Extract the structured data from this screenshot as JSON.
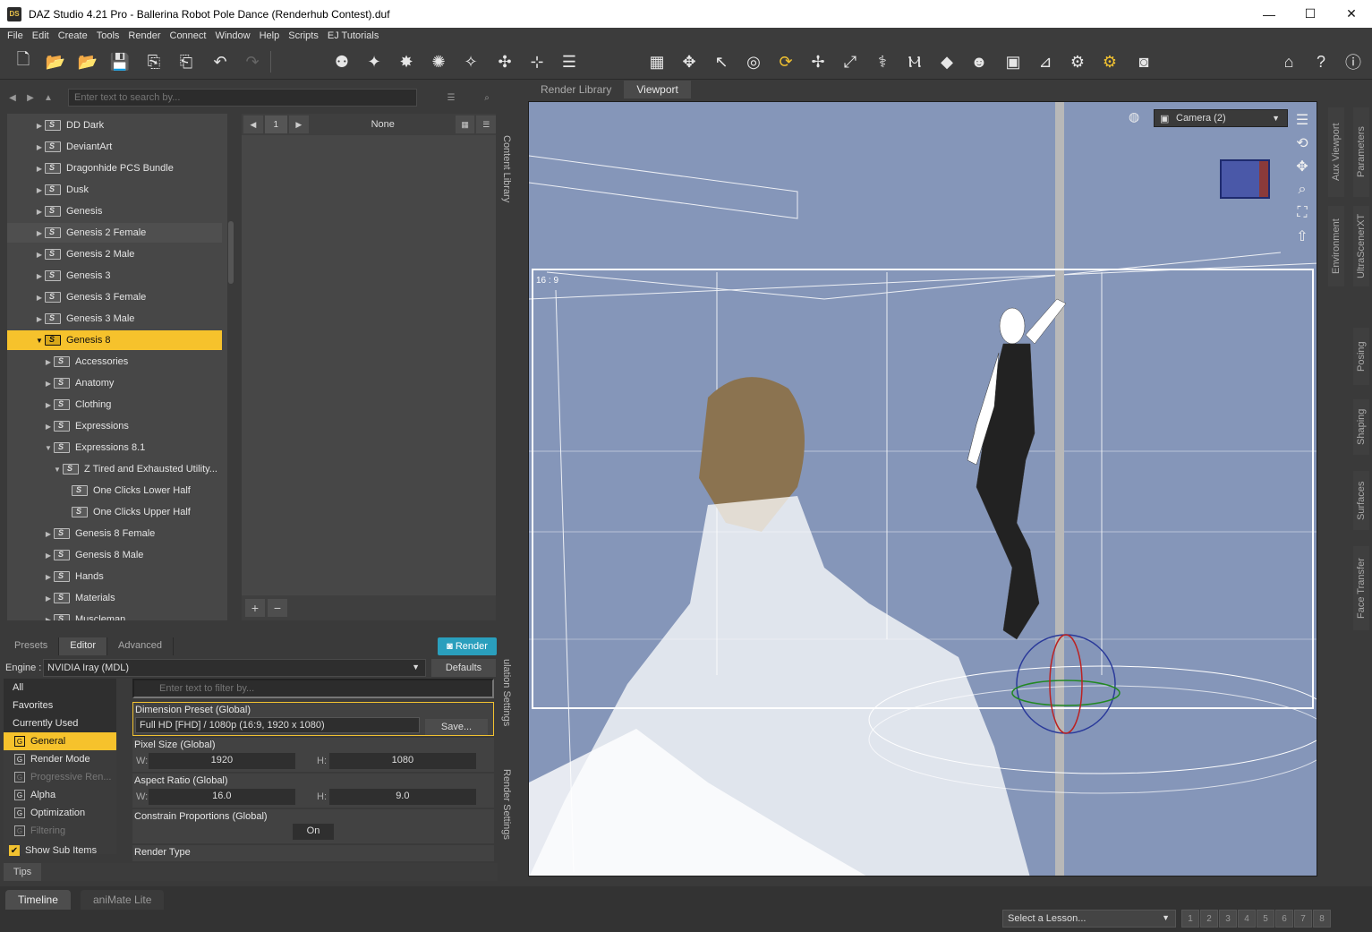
{
  "window": {
    "title": "DAZ Studio 4.21 Pro - Ballerina Robot Pole Dance (Renderhub Contest).duf",
    "logo_text": "DS",
    "controls": [
      "—",
      "☐",
      "✕"
    ]
  },
  "menu": [
    "File",
    "Edit",
    "Create",
    "Tools",
    "Render",
    "Connect",
    "Window",
    "Help",
    "Scripts",
    "EJ Tutorials"
  ],
  "content_library": {
    "search_placeholder": "Enter text to search by...",
    "side_tab_label": "Content Library",
    "tree": [
      {
        "label": "DD Dark",
        "level": 0,
        "expanded": false
      },
      {
        "label": "DeviantArt",
        "level": 0,
        "expanded": false
      },
      {
        "label": "Dragonhide PCS Bundle",
        "level": 0,
        "expanded": false
      },
      {
        "label": "Dusk",
        "level": 0,
        "expanded": false
      },
      {
        "label": "Genesis",
        "level": 0,
        "expanded": false
      },
      {
        "label": "Genesis 2 Female",
        "level": 0,
        "expanded": false,
        "hover": true
      },
      {
        "label": "Genesis 2 Male",
        "level": 0,
        "expanded": false
      },
      {
        "label": "Genesis 3",
        "level": 0,
        "expanded": false
      },
      {
        "label": "Genesis 3 Female",
        "level": 0,
        "expanded": false
      },
      {
        "label": "Genesis 3 Male",
        "level": 0,
        "expanded": false
      },
      {
        "label": "Genesis 8",
        "level": 0,
        "expanded": true,
        "selected": true
      },
      {
        "label": "Accessories",
        "level": 1,
        "expanded": false
      },
      {
        "label": "Anatomy",
        "level": 1,
        "expanded": false
      },
      {
        "label": "Clothing",
        "level": 1,
        "expanded": false
      },
      {
        "label": "Expressions",
        "level": 1,
        "expanded": false
      },
      {
        "label": "Expressions 8.1",
        "level": 1,
        "expanded": true
      },
      {
        "label": "Z Tired and Exhausted Utility...",
        "level": 2,
        "expanded": true
      },
      {
        "label": "One Clicks Lower Half",
        "level": 3,
        "leaf": true
      },
      {
        "label": "One Clicks Upper Half",
        "level": 3,
        "leaf": true
      },
      {
        "label": "Genesis 8 Female",
        "level": 1,
        "expanded": false
      },
      {
        "label": "Genesis 8 Male",
        "level": 1,
        "expanded": false
      },
      {
        "label": "Hands",
        "level": 1,
        "expanded": false
      },
      {
        "label": "Materials",
        "level": 1,
        "expanded": false
      },
      {
        "label": "Muscleman",
        "level": 1,
        "expanded": false
      }
    ],
    "grid": {
      "page": "1",
      "filter_label": "None"
    }
  },
  "render_settings": {
    "tabs": [
      "Presets",
      "Editor",
      "Advanced"
    ],
    "active_tab": "Editor",
    "render_button": "Render",
    "engine_label": "Engine :",
    "engine_value": "NVIDIA Iray (MDL)",
    "defaults_button": "Defaults",
    "side_tab_label": "Render Settings",
    "side_tab_label2": "ulation Settings",
    "filter_placeholder": "Enter text to filter by...",
    "groups": [
      {
        "label": "All",
        "type": "plain"
      },
      {
        "label": "Favorites",
        "type": "plain"
      },
      {
        "label": "Currently Used",
        "type": "plain"
      },
      {
        "label": "General",
        "type": "group",
        "selected": true
      },
      {
        "label": "Render Mode",
        "type": "group"
      },
      {
        "label": "Progressive Ren...",
        "type": "group",
        "dim": true
      },
      {
        "label": "Alpha",
        "type": "group"
      },
      {
        "label": "Optimization",
        "type": "group"
      },
      {
        "label": "Filtering",
        "type": "group",
        "dim": true
      }
    ],
    "show_sub_items": "Show Sub Items",
    "props": {
      "dimension_preset_label": "Dimension Preset (Global)",
      "dimension_preset_value": "Full HD [FHD] / 1080p (16:9, 1920 x 1080)",
      "save_button": "Save...",
      "pixel_size_label": "Pixel Size (Global)",
      "pixel_w": "1920",
      "pixel_h": "1080",
      "aspect_label": "Aspect Ratio (Global)",
      "aspect_w": "16.0",
      "aspect_h": "9.0",
      "constrain_label": "Constrain Proportions (Global)",
      "constrain_value": "On",
      "render_type_label": "Render Type",
      "w_label": "W:",
      "h_label": "H:"
    }
  },
  "tips": "Tips",
  "viewport": {
    "tabs": [
      "Render Library",
      "Viewport"
    ],
    "active_tab": "Viewport",
    "camera": "Camera (2)",
    "aspect_label": "16 : 9"
  },
  "right_tabs": [
    "Aux Viewport",
    "Parameters",
    "Environment",
    "UltraScenerXT",
    "Posing",
    "Shaping",
    "Surfaces",
    "Face Transfer"
  ],
  "bottom": {
    "tabs": [
      "Timeline",
      "aniMate Lite"
    ],
    "active_tab": "Timeline",
    "lesson_placeholder": "Select a Lesson...",
    "steps": [
      "1",
      "2",
      "3",
      "4",
      "5",
      "6",
      "7",
      "8"
    ]
  },
  "colors": {
    "accent": "#f6c22c",
    "render_button": "#2a9fbd",
    "viewport_bg": "#8596b9"
  }
}
